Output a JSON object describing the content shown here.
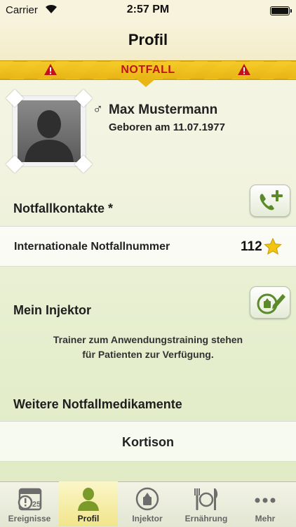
{
  "status_bar": {
    "carrier": "Carrier",
    "time": "2:57 PM"
  },
  "nav": {
    "title": "Profil"
  },
  "emergency_banner": {
    "label": "NOTFALL"
  },
  "profile": {
    "gender_symbol": "♂",
    "name": "Max Mustermann",
    "birth": "Geboren am 11.07.1977"
  },
  "contacts": {
    "heading": "Notfallkontakte *",
    "rows": [
      {
        "label": "Internationale Notfallnummer",
        "number": "112"
      }
    ]
  },
  "injector": {
    "heading": "Mein Injektor",
    "note_line1": "Trainer zum Anwendungstraining stehen",
    "note_line2": "für Patienten zur Verfügung."
  },
  "medications": {
    "heading": "Weitere Notfallmedikamente",
    "items": [
      "Kortison"
    ]
  },
  "tabs": [
    {
      "label": "Ereignisse",
      "icon": "calendar-icon",
      "badge": "25",
      "active": false
    },
    {
      "label": "Profil",
      "icon": "person-icon",
      "active": true
    },
    {
      "label": "Injektor",
      "icon": "injector-icon",
      "active": false
    },
    {
      "label": "Ernährung",
      "icon": "fork-plate-knife-icon",
      "active": false
    },
    {
      "label": "Mehr",
      "icon": "more-icon",
      "active": false
    }
  ],
  "colors": {
    "banner": "#f2c418",
    "banner_text": "#c0121b",
    "accent_green": "#5a8a2a"
  }
}
